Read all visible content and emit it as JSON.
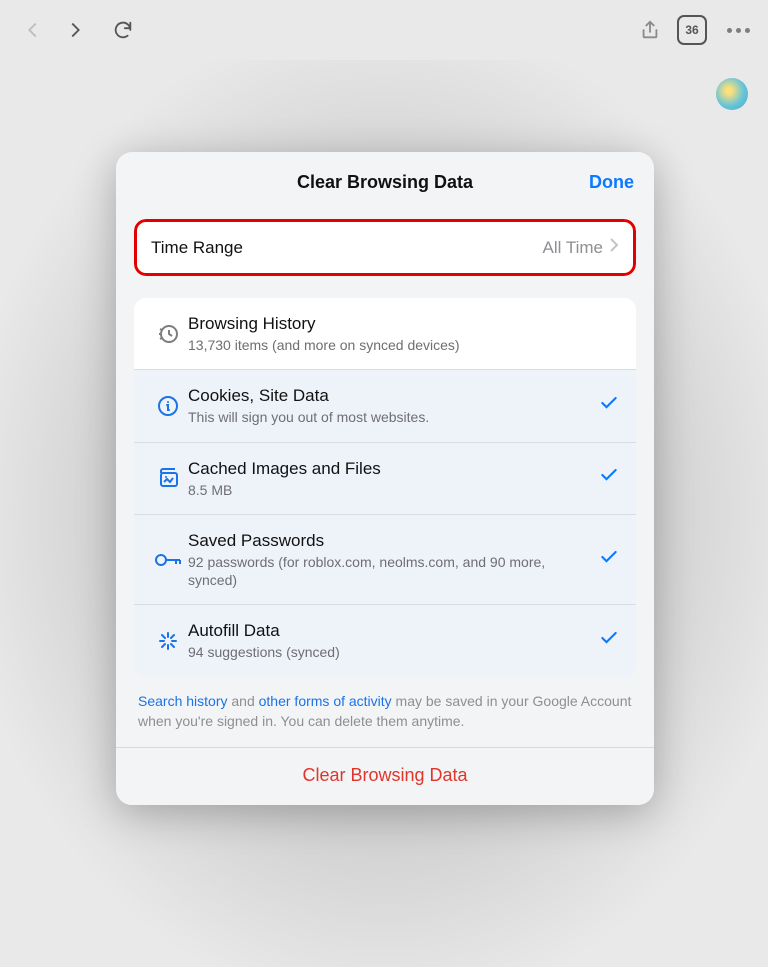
{
  "toolbar": {
    "tab_count": "36"
  },
  "modal": {
    "title": "Clear Browsing Data",
    "done": "Done",
    "time_range_label": "Time Range",
    "time_range_value": "All Time",
    "items": [
      {
        "title": "Browsing History",
        "sub": "13,730 items (and more on synced devices)",
        "checked": false,
        "icon": "history"
      },
      {
        "title": "Cookies, Site Data",
        "sub": "This will sign you out of most websites.",
        "checked": true,
        "icon": "info"
      },
      {
        "title": "Cached Images and Files",
        "sub": "8.5 MB",
        "checked": true,
        "icon": "images"
      },
      {
        "title": "Saved Passwords",
        "sub": "92 passwords (for roblox.com, neolms.com, and 90 more, synced)",
        "checked": true,
        "icon": "key"
      },
      {
        "title": "Autofill Data",
        "sub": "94 suggestions (synced)",
        "checked": true,
        "icon": "autofill"
      }
    ],
    "footnote_1": "Search history",
    "footnote_2": " and ",
    "footnote_3": "other forms of activity",
    "footnote_4": " may be saved in your Google Account when you're signed in. You can delete them anytime.",
    "clear_button": "Clear Browsing Data"
  }
}
